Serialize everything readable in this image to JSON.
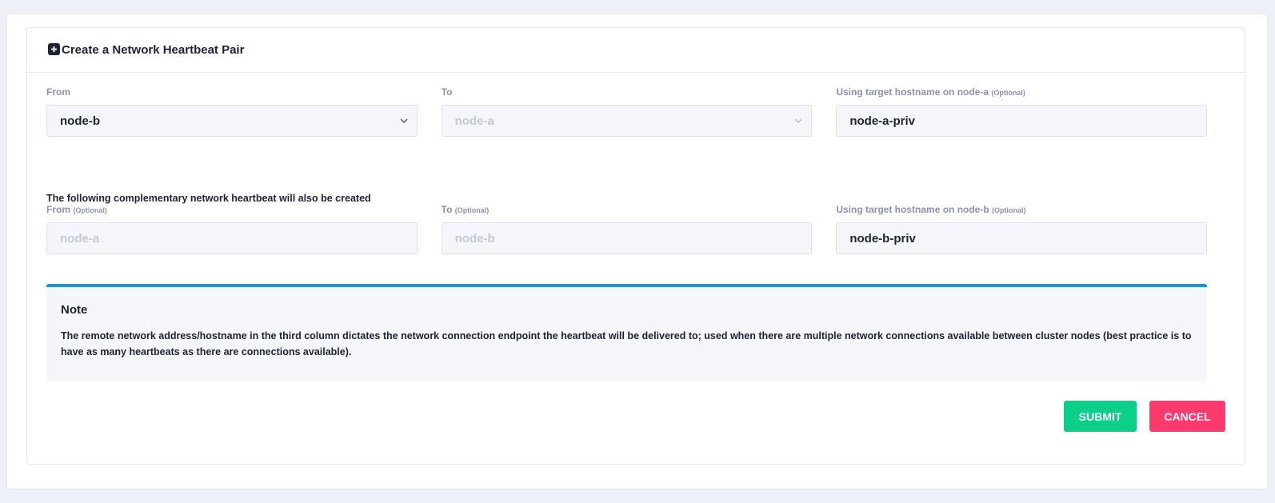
{
  "card": {
    "title": "Create a Network Heartbeat Pair",
    "icon": "plus-square-icon"
  },
  "primary": {
    "from": {
      "label": "From",
      "value": "node-b"
    },
    "to": {
      "label": "To",
      "value": "node-a"
    },
    "hostname": {
      "label": "Using target hostname on node-a",
      "optional": "(Optional)",
      "value": "node-a-priv"
    }
  },
  "complementary": {
    "title": "The following complementary network heartbeat will also be created",
    "from": {
      "label": "From",
      "optional": "(Optional)",
      "placeholder": "node-a"
    },
    "to": {
      "label": "To",
      "optional": "(Optional)",
      "placeholder": "node-b"
    },
    "hostname": {
      "label": "Using target hostname on node-b",
      "optional": "(Optional)",
      "value": "node-b-priv"
    }
  },
  "note": {
    "title": "Note",
    "body": "The remote network address/hostname in the third column dictates the network connection endpoint the heartbeat will be delivered to; used when there are multiple network connections available between cluster nodes (best practice is to have as many heartbeats as there are connections available)."
  },
  "actions": {
    "submit": "SUBMIT",
    "cancel": "CANCEL"
  },
  "colors": {
    "accent_blue": "#1a8fe3",
    "submit": "#0ccf8a",
    "cancel": "#fd3a6e"
  }
}
